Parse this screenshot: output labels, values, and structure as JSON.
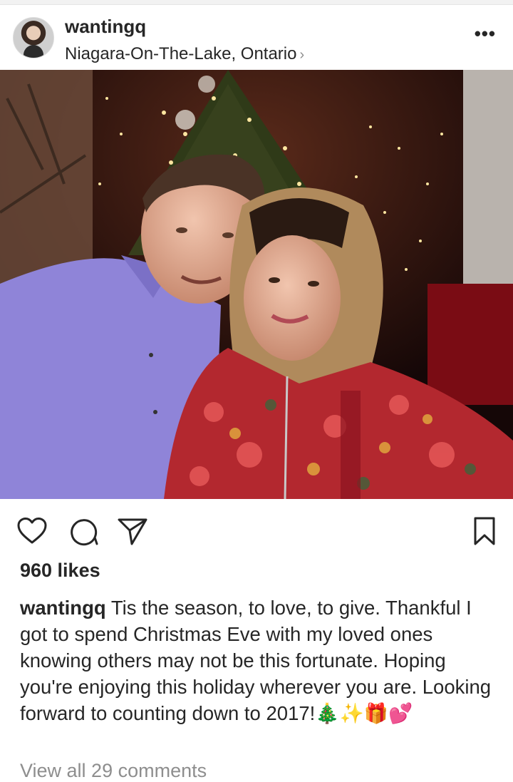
{
  "post": {
    "username": "wantingq",
    "location": "Niagara-On-The-Lake, Ontario",
    "location_chevron": "›",
    "more_label": "•••",
    "likes": "960 likes",
    "caption_user": "wantingq",
    "caption_text": " Tis the season, to love, to give. Thankful I got to spend Christmas Eve with my loved ones knowing others may not be this fortunate. Hoping you're enjoying this holiday wherever you are. Looking forward to counting down to 2017!🎄✨🎁💕",
    "comments_link": "View all 29 comments"
  },
  "icons": {
    "like": "heart-icon",
    "comment": "comment-icon",
    "share": "send-icon",
    "save": "bookmark-icon"
  },
  "colors": {
    "text": "#262626",
    "muted": "#8e8e8e",
    "shirt": "#8f84d8",
    "dress": "#b3282f"
  }
}
